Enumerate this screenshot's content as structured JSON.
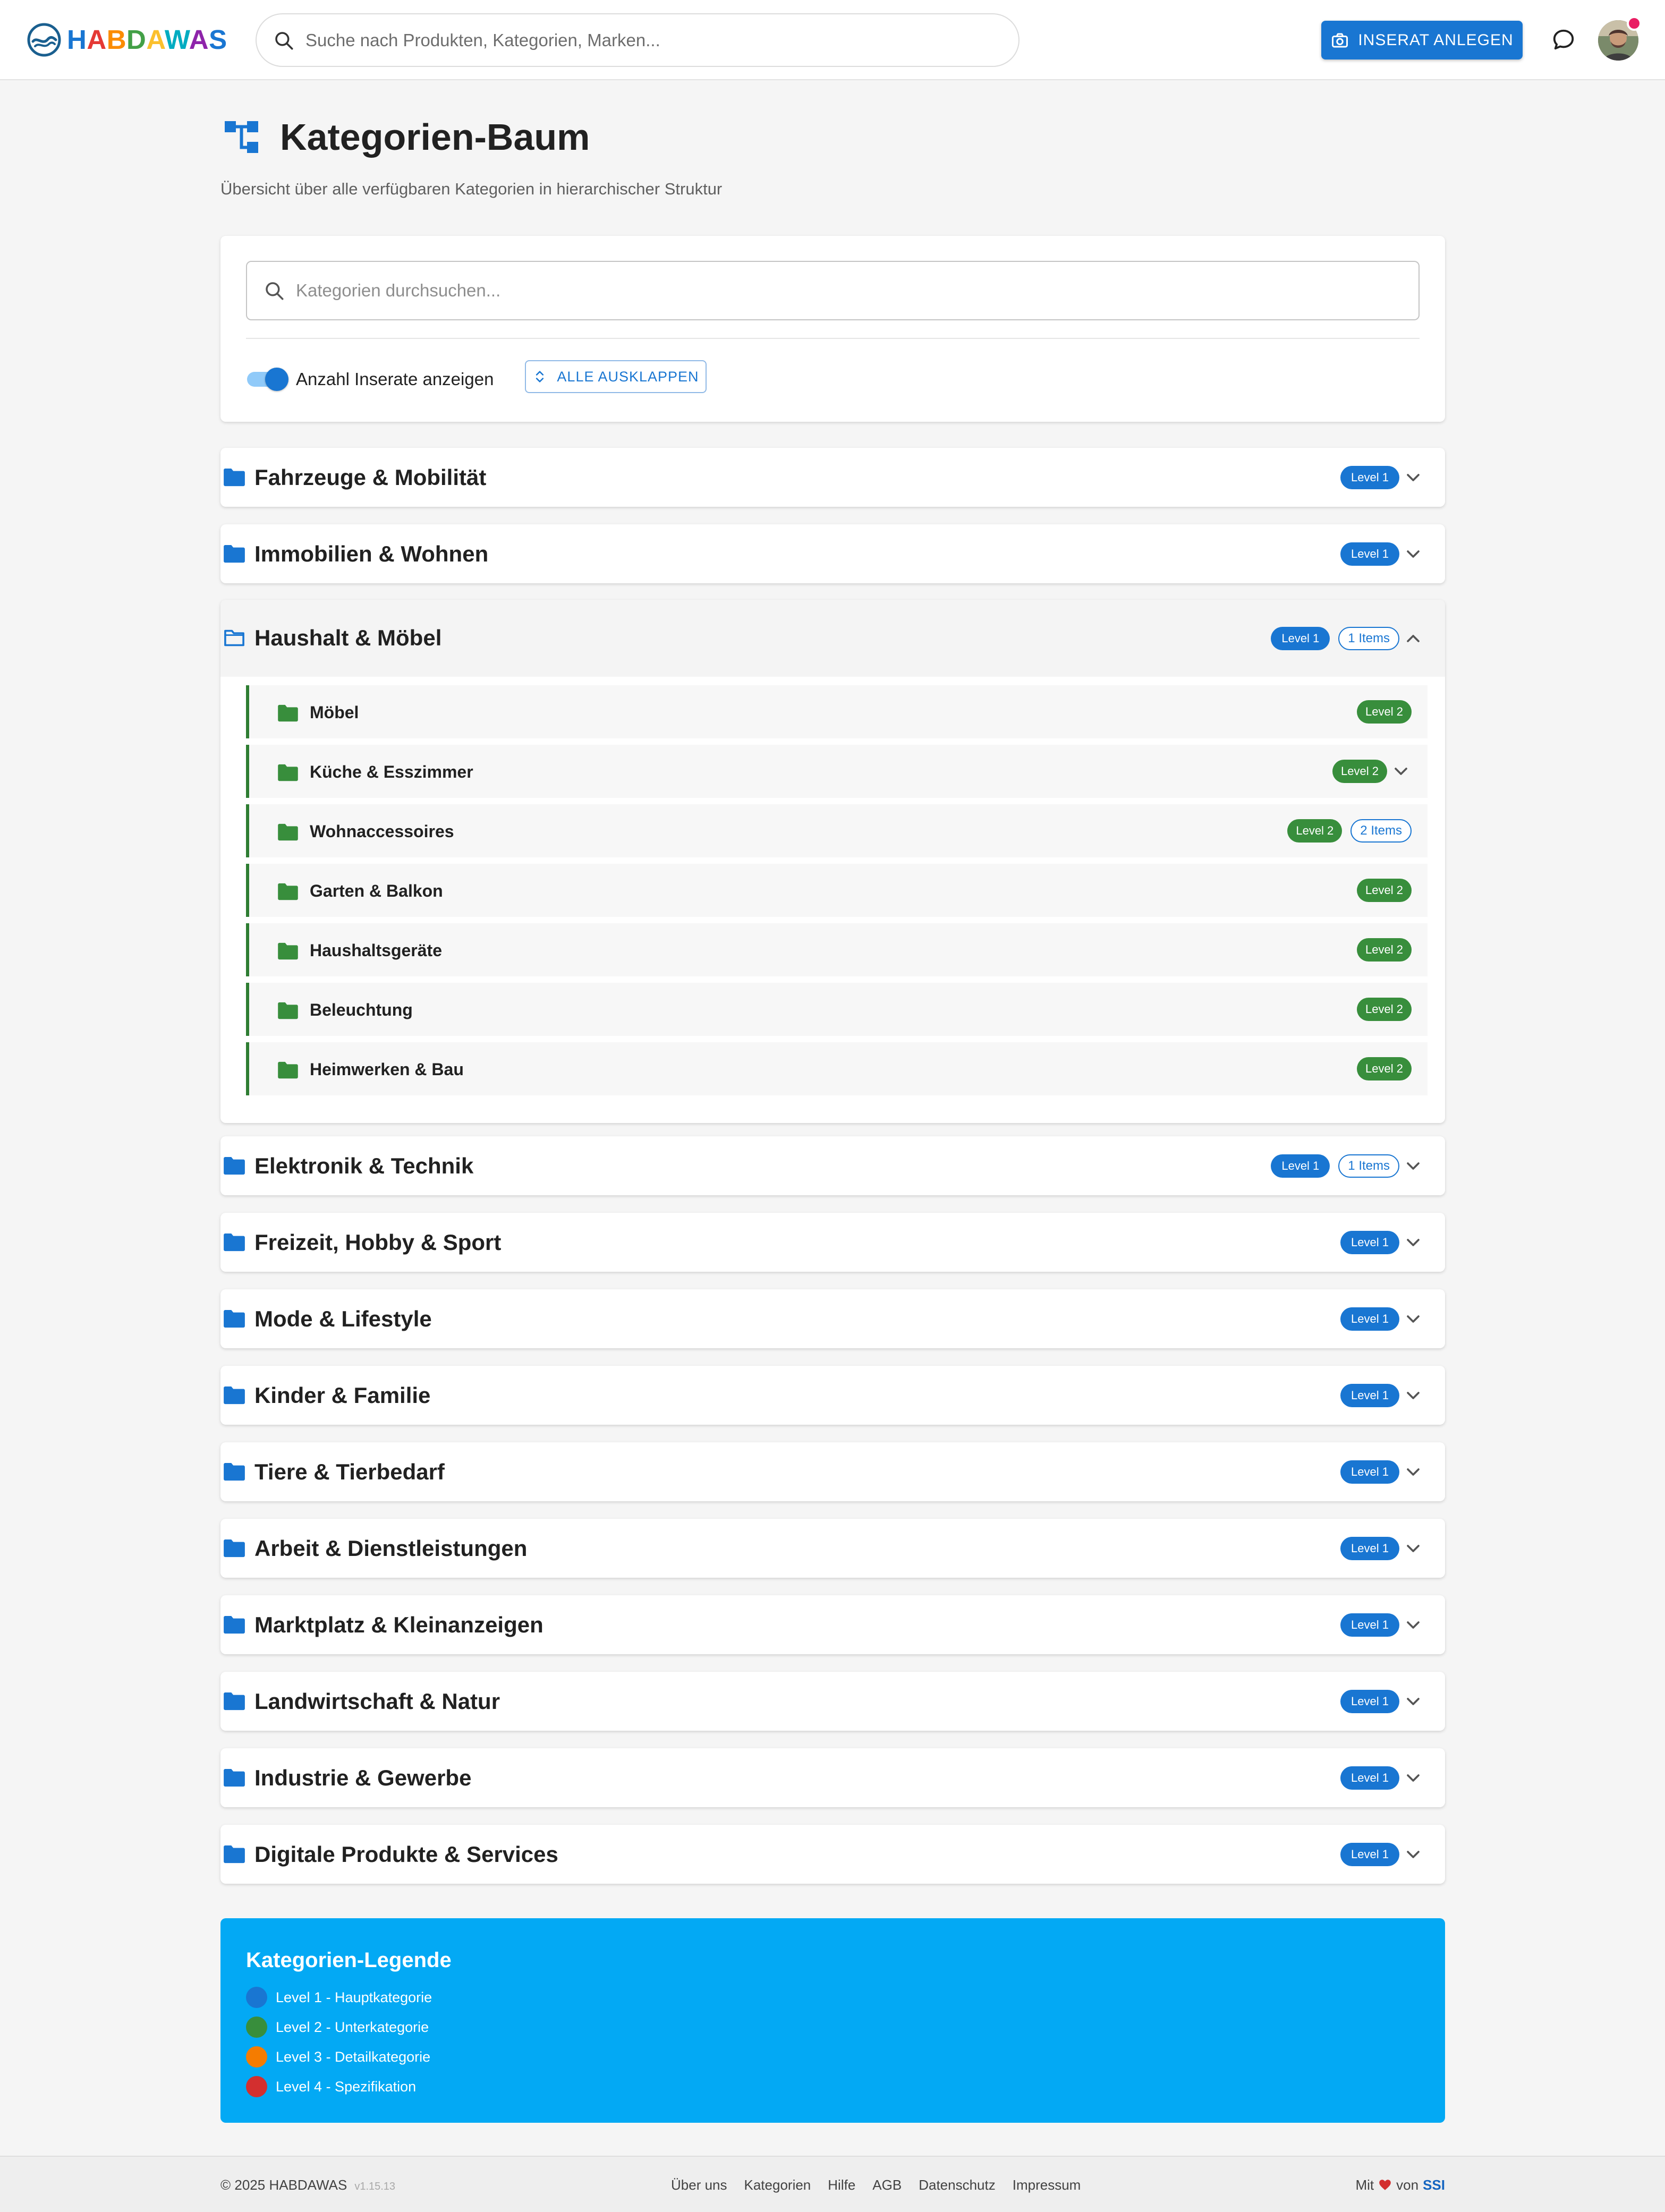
{
  "header": {
    "logo_letters": [
      {
        "ch": "H",
        "color": "#1976d2"
      },
      {
        "ch": "A",
        "color": "#e53935"
      },
      {
        "ch": "B",
        "color": "#fb8c00"
      },
      {
        "ch": "D",
        "color": "#43a047"
      },
      {
        "ch": "A",
        "color": "#fbc02d"
      },
      {
        "ch": "W",
        "color": "#00acc1"
      },
      {
        "ch": "A",
        "color": "#8e24aa"
      },
      {
        "ch": "S",
        "color": "#1976d2"
      }
    ],
    "search_placeholder": "Suche nach Produkten, Kategorien, Marken...",
    "create_button_label": "INSERAT ANLEGEN",
    "create_button_icon": "camera-icon",
    "messages_icon": "chat-bubble-icon",
    "has_notification": true
  },
  "page": {
    "title": "Kategorien-Baum",
    "title_icon": "account-tree-icon",
    "subtitle": "Übersicht über alle verfügbaren Kategorien in hierarchischer Struktur"
  },
  "controls": {
    "search_placeholder": "Kategorien durchsuchen...",
    "toggle_label": "Anzahl Inserate anzeigen",
    "toggle_on": true,
    "expand_all_label": "ALLE AUSKLAPPEN"
  },
  "categories": [
    {
      "name": "Fahrzeuge & Mobilität",
      "level": "Level 1",
      "items": ""
    },
    {
      "name": "Immobilien & Wohnen",
      "level": "Level 1",
      "items": ""
    },
    {
      "name": "Haushalt & Möbel",
      "level": "Level 1",
      "items": "1 Items",
      "expanded": true,
      "children": [
        {
          "name": "Möbel",
          "level": "Level 2",
          "items": "",
          "has_children": false
        },
        {
          "name": "Küche & Esszimmer",
          "level": "Level 2",
          "items": "",
          "has_children": true
        },
        {
          "name": "Wohnaccessoires",
          "level": "Level 2",
          "items": "2 Items",
          "has_children": false
        },
        {
          "name": "Garten & Balkon",
          "level": "Level 2",
          "items": "",
          "has_children": false
        },
        {
          "name": "Haushaltsgeräte",
          "level": "Level 2",
          "items": "",
          "has_children": false
        },
        {
          "name": "Beleuchtung",
          "level": "Level 2",
          "items": "",
          "has_children": false
        },
        {
          "name": "Heimwerken & Bau",
          "level": "Level 2",
          "items": "",
          "has_children": false
        }
      ]
    },
    {
      "name": "Elektronik & Technik",
      "level": "Level 1",
      "items": "1 Items"
    },
    {
      "name": "Freizeit, Hobby & Sport",
      "level": "Level 1",
      "items": ""
    },
    {
      "name": "Mode & Lifestyle",
      "level": "Level 1",
      "items": ""
    },
    {
      "name": "Kinder & Familie",
      "level": "Level 1",
      "items": ""
    },
    {
      "name": "Tiere & Tierbedarf",
      "level": "Level 1",
      "items": ""
    },
    {
      "name": "Arbeit & Dienstleistungen",
      "level": "Level 1",
      "items": ""
    },
    {
      "name": "Marktplatz & Kleinanzeigen",
      "level": "Level 1",
      "items": ""
    },
    {
      "name": "Landwirtschaft & Natur",
      "level": "Level 1",
      "items": ""
    },
    {
      "name": "Industrie & Gewerbe",
      "level": "Level 1",
      "items": ""
    },
    {
      "name": "Digitale Produkte & Services",
      "level": "Level 1",
      "items": ""
    }
  ],
  "legend": {
    "title": "Kategorien-Legende",
    "entries": [
      {
        "label": "Level 1 - Hauptkategorie",
        "color": "#1976d2"
      },
      {
        "label": "Level 2 - Unterkategorie",
        "color": "#388e3c"
      },
      {
        "label": "Level 3 - Detailkategorie",
        "color": "#f57c00"
      },
      {
        "label": "Level 4 - Spezifikation",
        "color": "#d32f2f"
      }
    ]
  },
  "colors": {
    "primary": "#1976d2",
    "level2": "#388e3c",
    "legend_bg": "#03a9f4"
  },
  "footer": {
    "copyright": "© 2025 HABDAWAS",
    "version": "v1.15.13",
    "links": [
      "Über uns",
      "Kategorien",
      "Hilfe",
      "AGB",
      "Datenschutz",
      "Impressum"
    ],
    "made_prefix": "Mit",
    "made_middle": "von",
    "made_brand": "SSI"
  }
}
